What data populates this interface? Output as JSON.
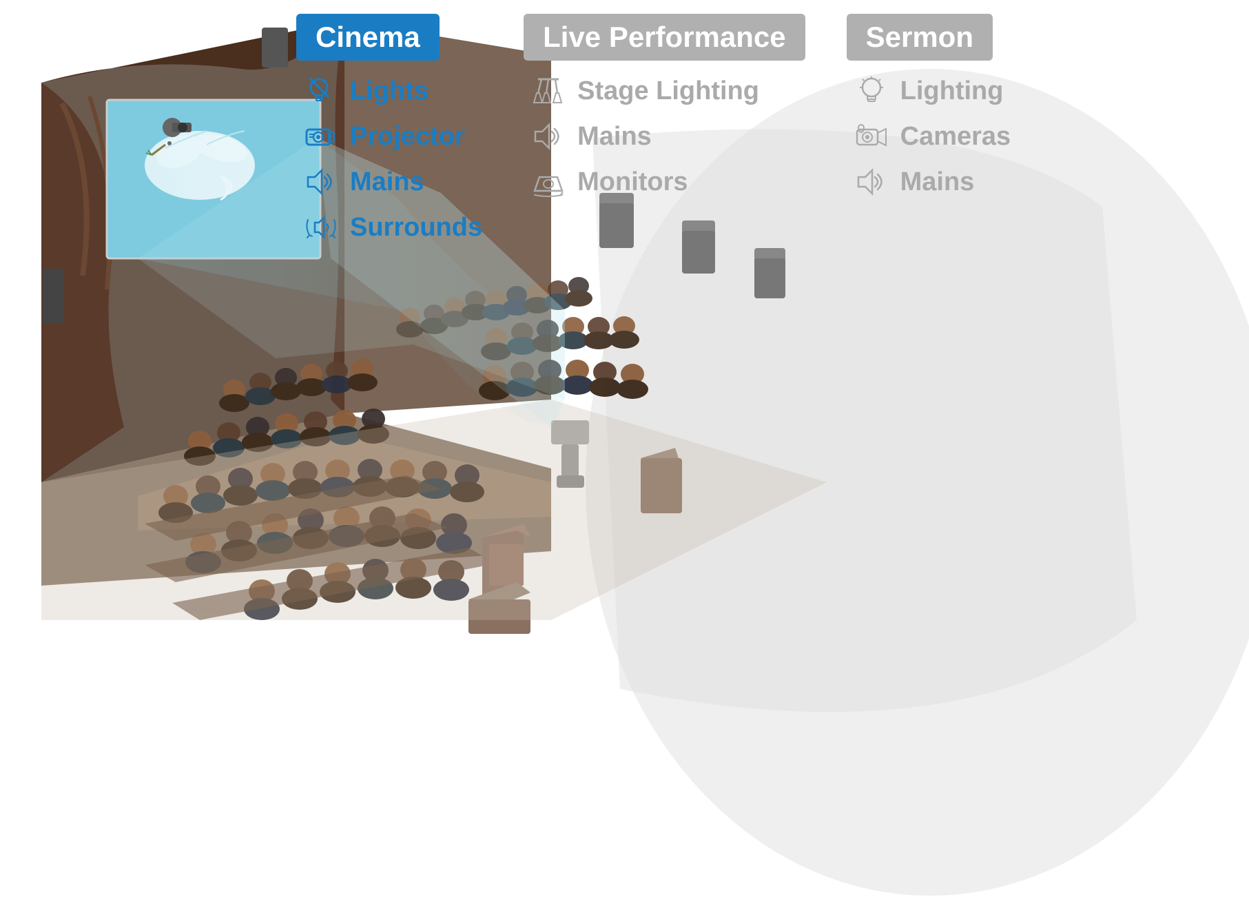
{
  "panels": [
    {
      "id": "cinema",
      "header": "Cinema",
      "header_style": "active",
      "items": [
        {
          "id": "lights",
          "label": "Lights",
          "label_style": "blue",
          "icon": "lights",
          "icon_style": "blue"
        },
        {
          "id": "projector",
          "label": "Projector",
          "label_style": "blue",
          "icon": "projector",
          "icon_style": "blue"
        },
        {
          "id": "mains",
          "label": "Mains",
          "label_style": "blue",
          "icon": "speaker-mains",
          "icon_style": "blue"
        },
        {
          "id": "surrounds",
          "label": "Surrounds",
          "label_style": "blue",
          "icon": "speaker-surrounds",
          "icon_style": "blue"
        }
      ]
    },
    {
      "id": "live-performance",
      "header": "Live Performance",
      "header_style": "inactive",
      "items": [
        {
          "id": "stage-lighting",
          "label": "Stage Lighting",
          "label_style": "gray",
          "icon": "stage-lighting",
          "icon_style": "gray"
        },
        {
          "id": "mains-lp",
          "label": "Mains",
          "label_style": "gray",
          "icon": "speaker-mains",
          "icon_style": "gray"
        },
        {
          "id": "monitors",
          "label": "Monitors",
          "label_style": "gray",
          "icon": "monitors",
          "icon_style": "gray"
        }
      ]
    },
    {
      "id": "sermon",
      "header": "Sermon",
      "header_style": "inactive",
      "items": [
        {
          "id": "lighting-s",
          "label": "Lighting",
          "label_style": "gray",
          "icon": "bulb",
          "icon_style": "gray"
        },
        {
          "id": "cameras",
          "label": "Cameras",
          "label_style": "gray",
          "icon": "camera",
          "icon_style": "gray"
        },
        {
          "id": "mains-s",
          "label": "Mains",
          "label_style": "gray",
          "icon": "speaker-mains",
          "icon_style": "gray"
        }
      ]
    }
  ],
  "illustration_alt": "Isometric view of a multi-purpose venue showing cinema, live performance, and sermon setups with audience seating, projection screen, and lighting rigs"
}
